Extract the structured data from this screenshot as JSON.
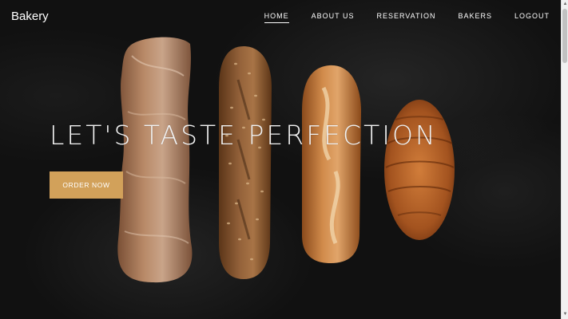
{
  "brand": "Bakery",
  "nav": {
    "items": [
      "HOME",
      "ABOUT US",
      "RESERVATION",
      "BAKERS",
      "LOGOUT"
    ],
    "active": "HOME"
  },
  "hero": {
    "headline": "LET'S TASTE PERFECTION",
    "cta_label": "ORDER NOW"
  },
  "colors": {
    "accent": "#d2a15a",
    "background": "#111111",
    "text": "#ffffff"
  }
}
